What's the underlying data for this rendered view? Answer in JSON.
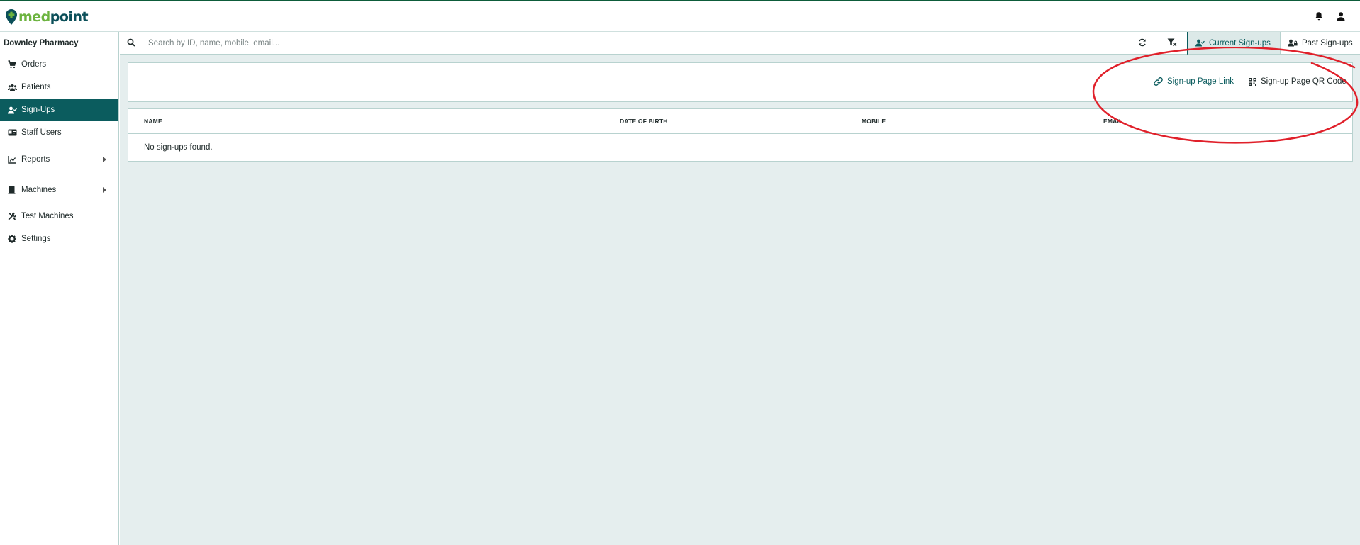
{
  "app": {
    "brand_part1": "med",
    "brand_part2": "point",
    "brand_colors": {
      "green": "#6cb33f",
      "teal": "#0b4f59"
    },
    "accent_color": "#0b5c5e",
    "annotation_color": "#e0202a"
  },
  "header": {
    "icons": [
      "bell-icon",
      "user-icon"
    ]
  },
  "sidebar": {
    "pharmacy_name": "Downley Pharmacy",
    "items": [
      {
        "label": "Orders",
        "icon": "cart-icon",
        "active": false
      },
      {
        "label": "Patients",
        "icon": "users-icon",
        "active": false
      },
      {
        "label": "Sign-Ups",
        "icon": "user-check-icon",
        "active": true
      },
      {
        "label": "Staff Users",
        "icon": "id-card-icon",
        "active": false
      },
      {
        "label": "Reports",
        "icon": "chart-icon",
        "active": false,
        "expandable": true
      },
      {
        "label": "Machines",
        "icon": "machine-icon",
        "active": false,
        "expandable": true
      },
      {
        "label": "Test Machines",
        "icon": "tools-icon",
        "active": false
      },
      {
        "label": "Settings",
        "icon": "gear-icon",
        "active": false
      }
    ]
  },
  "search": {
    "placeholder": "Search by ID, name, mobile, email...",
    "value": ""
  },
  "toolbar": {
    "tabs": [
      {
        "label": "Current Sign-ups",
        "icon": "user-check-icon",
        "selected": true
      },
      {
        "label": "Past Sign-ups",
        "icon": "user-lock-icon",
        "selected": false
      }
    ]
  },
  "links": {
    "page_link": "Sign-up Page Link",
    "qr_code": "Sign-up Page QR Code"
  },
  "table": {
    "columns": [
      "NAME",
      "DATE OF BIRTH",
      "MOBILE",
      "EMAIL"
    ],
    "rows": [],
    "empty_message": "No sign-ups found."
  }
}
